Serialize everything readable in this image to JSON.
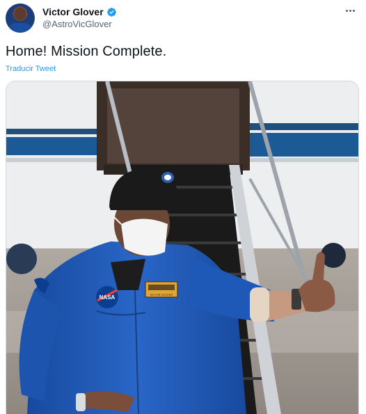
{
  "tweet": {
    "author": {
      "display_name": "Victor Glover",
      "handle": "@AstroVicGlover",
      "verified": true
    },
    "text": "Home! Mission Complete.",
    "translate_label": "Traducir Tweet",
    "media": {
      "type": "photo",
      "patch_name": "VICTOR GLOVER",
      "suit_logo": "NASA"
    }
  },
  "colors": {
    "link": "#1d9bf0",
    "verified": "#1d9bf0",
    "suit": "#1f59b8"
  },
  "icons": [
    "verified-badge-icon",
    "more-options-icon"
  ]
}
